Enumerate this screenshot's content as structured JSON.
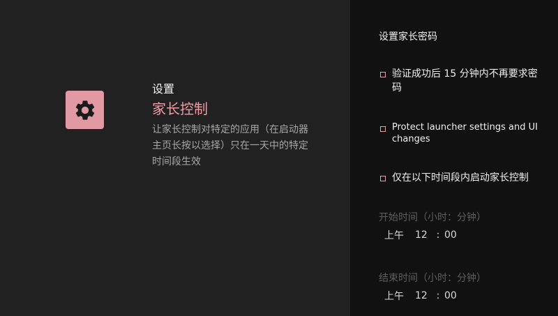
{
  "left": {
    "icon": "gear-icon",
    "breadcrumb": "设置",
    "title": "家长控制",
    "description": "让家长控制对特定的应用（在启动器主页长按以选择）只在一天中的特定时间段生效"
  },
  "right": {
    "section_title": "设置家长密码",
    "options": [
      {
        "label": "验证成功后 15 分钟内不再要求密码",
        "checked": false
      },
      {
        "label": "Protect launcher settings and UI changes",
        "checked": false
      },
      {
        "label": "仅在以下时间段内启动家长控制",
        "checked": false
      }
    ],
    "start_time": {
      "label": "开始时间（小时：分钟）",
      "ampm": "上午",
      "hour": "12",
      "separator": ":",
      "minute": "00"
    },
    "end_time": {
      "label": "结束时间（小时：分钟）",
      "ampm": "上午",
      "hour": "12",
      "separator": ":",
      "minute": "00"
    }
  },
  "colors": {
    "accent": "#f29aa6",
    "icon_bg": "#e19aa4",
    "left_bg": "#212121",
    "right_bg": "#111111"
  }
}
